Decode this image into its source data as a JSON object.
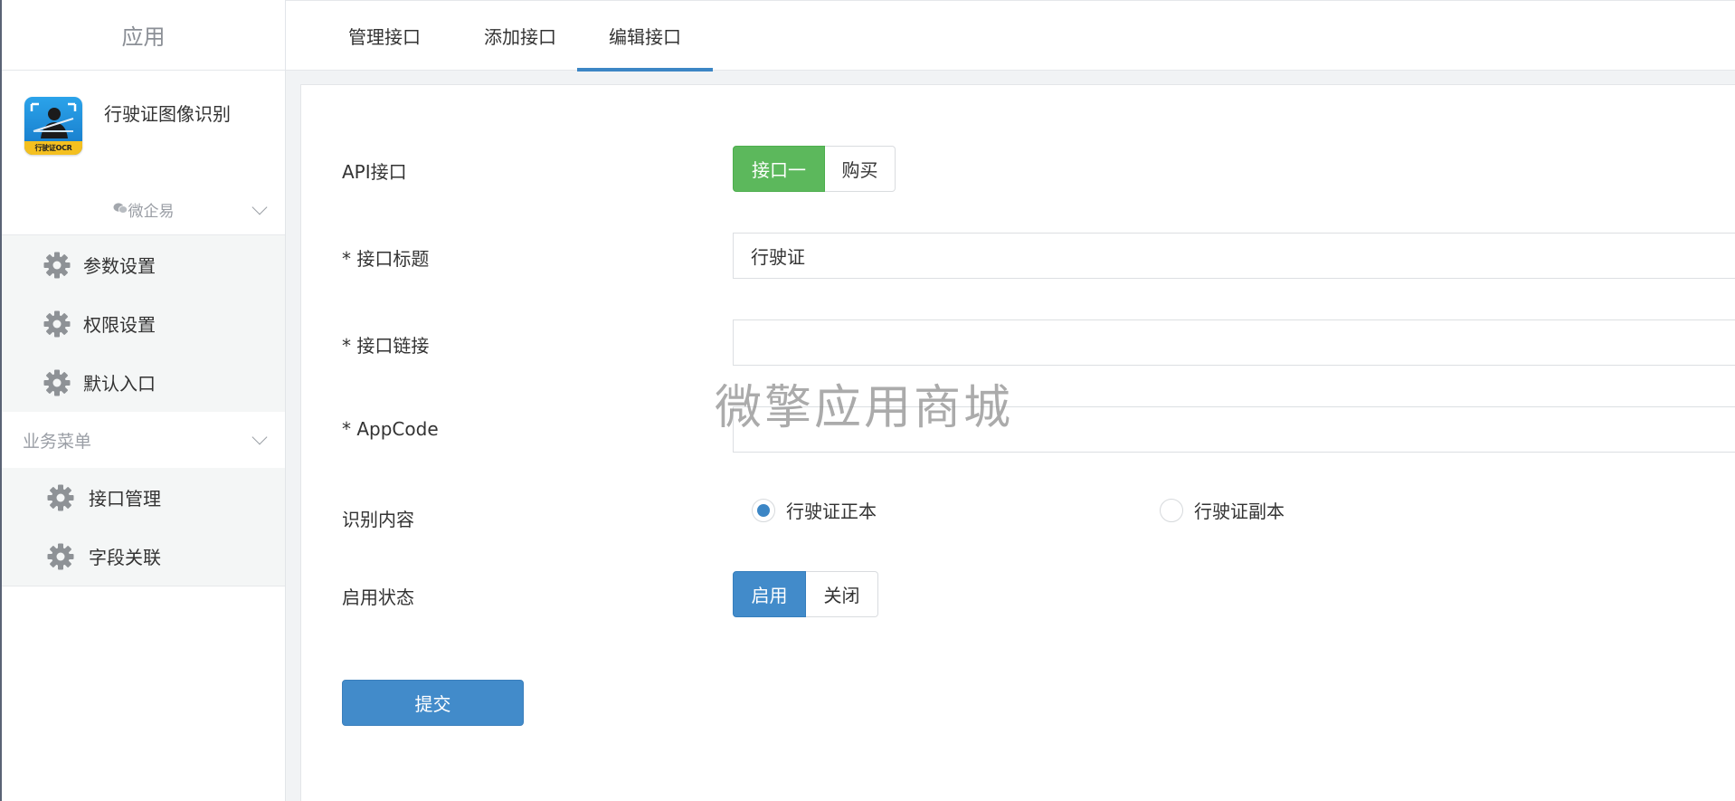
{
  "sidebar": {
    "header": "应用",
    "app": {
      "name": "行驶证图像识别",
      "logo_text": "行驶证OCR",
      "logo_colors": [
        "#2ba3ea",
        "#1577c7",
        "#f4c020"
      ]
    },
    "platform": {
      "label": "微企易",
      "icon": "wechat-icon"
    },
    "settings_items": [
      {
        "label": "参数设置",
        "icon": "gear-icon"
      },
      {
        "label": "权限设置",
        "icon": "gear-icon"
      },
      {
        "label": "默认入口",
        "icon": "gear-icon"
      }
    ],
    "business_section": {
      "label": "业务菜单"
    },
    "business_items": [
      {
        "label": "接口管理",
        "icon": "gear-icon"
      },
      {
        "label": "字段关联",
        "icon": "gear-icon"
      }
    ]
  },
  "tabs": [
    {
      "label": "管理接口"
    },
    {
      "label": "添加接口"
    },
    {
      "label": "编辑接口",
      "active": true
    }
  ],
  "form": {
    "api": {
      "label": "API接口",
      "options": [
        "接口一",
        "购买"
      ],
      "selected": "接口一"
    },
    "title": {
      "label": "* 接口标题",
      "value": "行驶证"
    },
    "link": {
      "label": "* 接口链接",
      "value": ""
    },
    "appcode": {
      "label": "* AppCode",
      "value": ""
    },
    "content": {
      "label": "识别内容",
      "options": [
        "行驶证正本",
        "行驶证副本"
      ],
      "selected": "行驶证正本"
    },
    "status": {
      "label": "启用状态",
      "options": [
        "启用",
        "关闭"
      ],
      "selected": "启用"
    },
    "submit_label": "提交"
  },
  "watermark": "微擎应用商城",
  "colors": {
    "accent_blue": "#428bca",
    "tab_underline": "#3c86c5",
    "success_green": "#5cb85c"
  }
}
